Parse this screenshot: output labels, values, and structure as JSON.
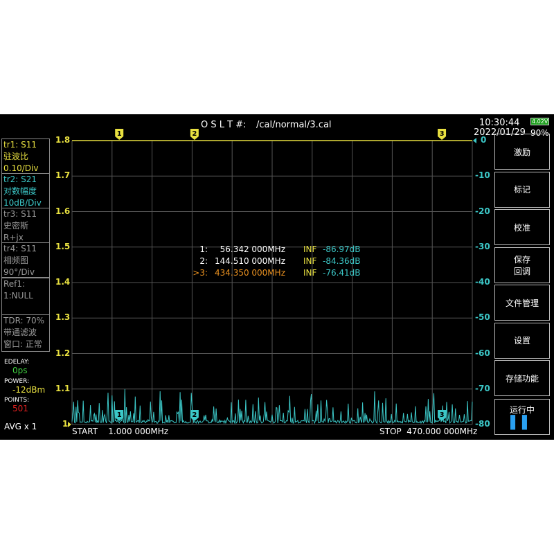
{
  "header": {
    "cal_label": "O S L T #:",
    "cal_file": "/cal/normal/3.cal",
    "time": "10:30:44",
    "date": "2022/01/29",
    "battery_voltage": "4.02V",
    "battery_percent": "90%"
  },
  "traces": [
    {
      "line1": "tr1:   S11",
      "line2": "驻波比",
      "line3": "0.10/Div",
      "color": "#e8e040"
    },
    {
      "line1": "tr2:   S21",
      "line2": "对数幅度",
      "line3": "10dB/Div",
      "color": "#3cc8c8"
    },
    {
      "line1": "tr3:   S11",
      "line2": "史密斯",
      "line3": "R+jx",
      "color": "#999999"
    },
    {
      "line1": "tr4:   S11",
      "line2": "相频图",
      "line3": "90°/Div",
      "color": "#999999"
    }
  ],
  "ref": {
    "line1": "Ref1:",
    "line2": "1:NULL"
  },
  "tdr": {
    "line1": "TDR: 70%",
    "line2": "带通滤波",
    "line3": "窗口: 正常"
  },
  "settings": {
    "edelay_label": "EDELAY:",
    "edelay": "0ps",
    "power_label": "POWER:",
    "power": "-12dBm",
    "points_label": "POINTS:",
    "points": "501",
    "avg": "AVG x 1"
  },
  "axis": {
    "left": [
      "1.8",
      "1.7",
      "1.6",
      "1.5",
      "1.4",
      "1.3",
      "1.2",
      "1.1",
      "1"
    ],
    "right": [
      "0",
      "-10",
      "-20",
      "-30",
      "-40",
      "-50",
      "-60",
      "-70",
      "-80"
    ],
    "start": "START    1.000 000MHz",
    "stop": "STOP  470.000 000MHz"
  },
  "markers": [
    {
      "id": "1",
      "label": "1:",
      "freq": "56.342 000MHz",
      "swr": "INF",
      "db": "-86.97dB",
      "active": false,
      "freq_mhz": 56.342
    },
    {
      "id": "2",
      "label": "2:",
      "freq": "144.510 000MHz",
      "swr": "INF",
      "db": "-84.36dB",
      "active": false,
      "freq_mhz": 144.51
    },
    {
      "id": "3",
      "label": ">3:",
      "freq": "434.350 000MHz",
      "swr": "INF",
      "db": "-76.41dB",
      "active": true,
      "freq_mhz": 434.35
    }
  ],
  "menu": [
    "激励",
    "标记",
    "校准",
    "保存\n回调",
    "文件管理",
    "设置",
    "存储功能"
  ],
  "run": {
    "label": "运行中",
    "icon": "pause-icon"
  },
  "colors": {
    "yellow": "#e8e040",
    "cyan": "#3cc8c8",
    "orange": "#e89020",
    "green": "#40d040",
    "red": "#e02020"
  }
}
